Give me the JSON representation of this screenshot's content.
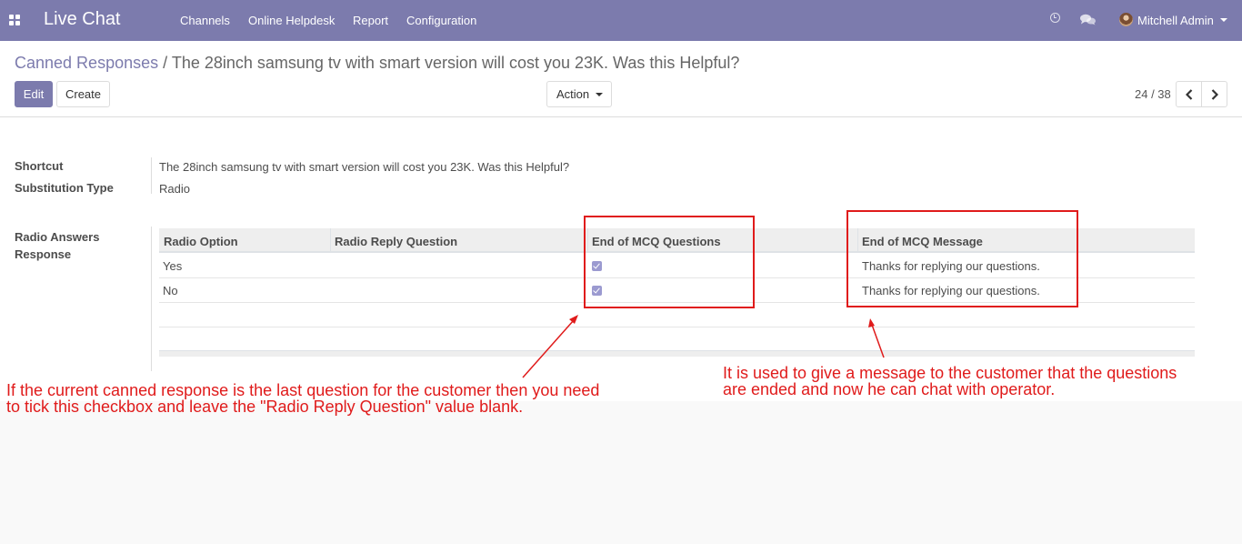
{
  "topbar": {
    "app_name": "Live Chat",
    "menu": [
      "Channels",
      "Online Helpdesk",
      "Report",
      "Configuration"
    ],
    "user_name": "Mitchell Admin",
    "icons": [
      "apps-icon",
      "clock-icon",
      "chat-icon",
      "avatar"
    ]
  },
  "breadcrumb": {
    "parent": "Canned Responses",
    "separator": "/",
    "current": "The 28inch samsung tv with smart version will cost you 23K. Was this Helpful?"
  },
  "buttons": {
    "edit": "Edit",
    "create": "Create",
    "action": "Action"
  },
  "pager": {
    "value": "24 / 38"
  },
  "form": {
    "shortcut_label": "Shortcut",
    "shortcut_value": "The 28inch samsung tv with smart version will cost you 23K. Was this Helpful?",
    "substitution_label": "Substitution Type",
    "substitution_value": "Radio",
    "radio_answers_label_1": "Radio Answers",
    "radio_answers_label_2": "Response"
  },
  "table": {
    "columns": [
      "Radio Option",
      "Radio Reply Question",
      "End of MCQ Questions",
      "End of MCQ Message"
    ],
    "rows": [
      {
        "option": "Yes",
        "reply_question": "",
        "end_of_mcq": true,
        "message": "Thanks for replying our questions."
      },
      {
        "option": "No",
        "reply_question": "",
        "end_of_mcq": true,
        "message": "Thanks for replying our questions."
      }
    ]
  },
  "annotations": {
    "left_line1": "If the current canned response is the last question for the customer then you need",
    "left_line2": "to tick this checkbox and leave the \"Radio Reply Question\" value blank.",
    "right_line1": "It is used to give a message to the customer that the questions",
    "right_line2": "are ended and now he can chat with operator."
  },
  "colors": {
    "brand": "#7c7bad",
    "annotation": "#e01b1b",
    "checkbox": "#9b9ad0"
  }
}
